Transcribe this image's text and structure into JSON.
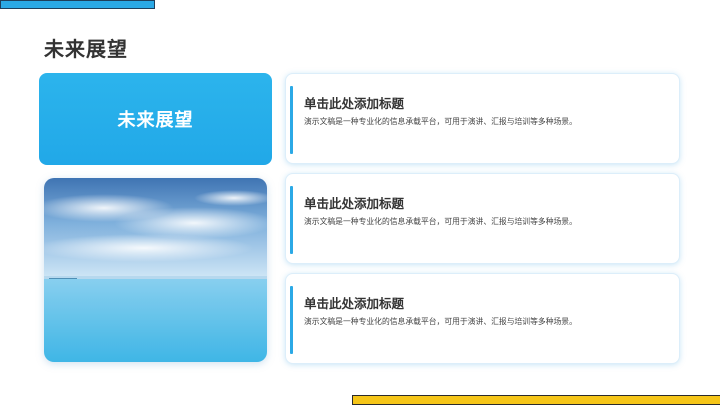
{
  "slide": {
    "title": "未来展望",
    "feature_label": "未来展望"
  },
  "cards": [
    {
      "title": "单击此处添加标题",
      "desc": "演示文稿是一种专业化的信息承载平台，可用于演讲、汇报与培训等多种场景。"
    },
    {
      "title": "单击此处添加标题",
      "desc": "演示文稿是一种专业化的信息承载平台，可用于演讲、汇报与培训等多种场景。"
    },
    {
      "title": "单击此处添加标题",
      "desc": "演示文稿是一种专业化的信息承载平台，可用于演讲、汇报与培训等多种场景。"
    }
  ],
  "colors": {
    "accent_blue": "#2ba9e6",
    "accent_yellow": "#f5c518",
    "title_text": "#333333"
  },
  "image": {
    "subject": "sky-and-sea-landscape"
  }
}
